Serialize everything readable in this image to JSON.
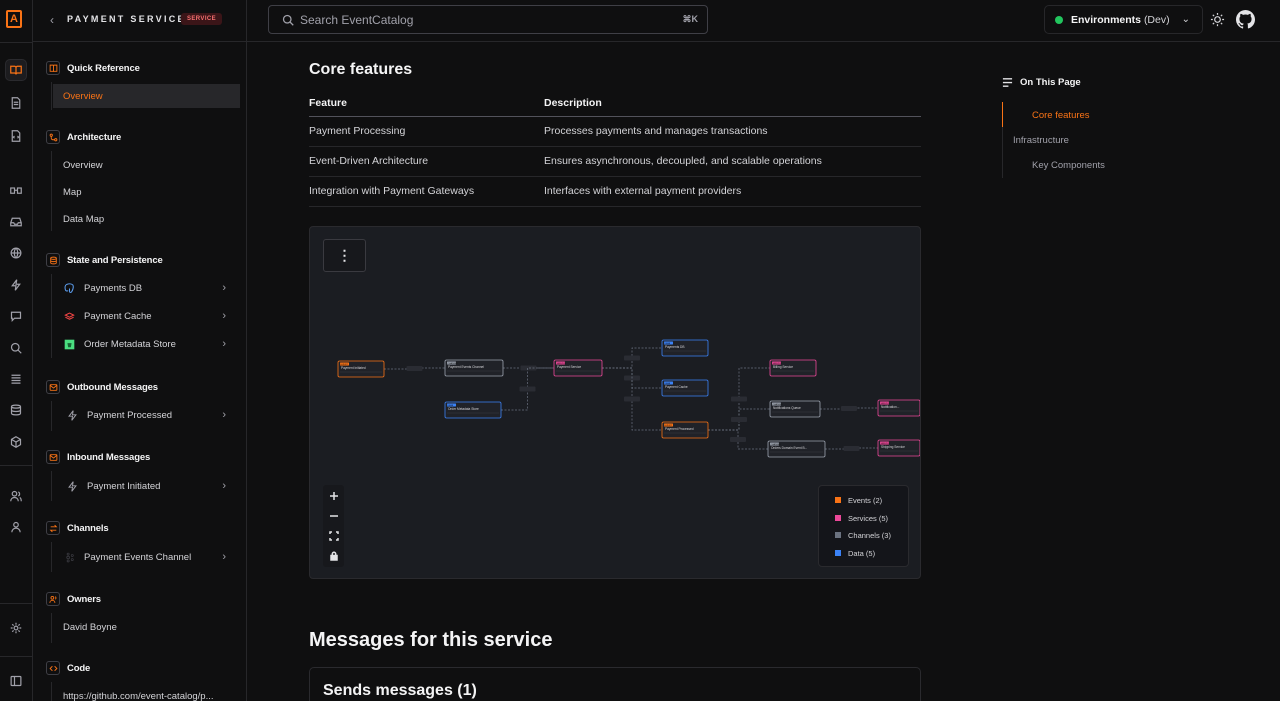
{
  "app": {
    "brand_letter": "A"
  },
  "sidebar": {
    "back": "‹",
    "title": "PAYMENT SERVICE",
    "badge": "SERVICE",
    "sections": [
      {
        "label": "Quick Reference",
        "items": [
          {
            "label": "Overview"
          }
        ]
      },
      {
        "label": "Architecture",
        "items": [
          {
            "label": "Overview"
          },
          {
            "label": "Map"
          },
          {
            "label": "Data Map"
          }
        ]
      },
      {
        "label": "State and Persistence",
        "items": [
          {
            "label": "Payments DB"
          },
          {
            "label": "Payment Cache"
          },
          {
            "label": "Order Metadata Store"
          }
        ]
      },
      {
        "label": "Outbound Messages",
        "items": [
          {
            "label": "Payment Processed"
          }
        ]
      },
      {
        "label": "Inbound Messages",
        "items": [
          {
            "label": "Payment Initiated"
          }
        ]
      },
      {
        "label": "Channels",
        "items": [
          {
            "label": "Payment Events Channel"
          }
        ]
      },
      {
        "label": "Owners",
        "items": [
          {
            "label": "David Boyne"
          }
        ]
      },
      {
        "label": "Code",
        "items": [
          {
            "label": "https://github.com/event-catalog/p..."
          }
        ]
      }
    ]
  },
  "topbar": {
    "search_placeholder": "Search EventCatalog",
    "shortcut": "⌘K",
    "env_label": "Environments",
    "env_value": "(Dev)",
    "env_status_color": "#22c55e"
  },
  "main": {
    "core_title": "Core features",
    "table": {
      "headers": [
        "Feature",
        "Description"
      ],
      "rows": [
        [
          "Payment Processing",
          "Processes payments and manages transactions"
        ],
        [
          "Event-Driven Architecture",
          "Ensures asynchronous, decoupled, and scalable operations"
        ],
        [
          "Integration with Payment Gateways",
          "Interfaces with external payment providers"
        ]
      ]
    },
    "graph": {
      "menu_icon": "⋮",
      "legend": [
        {
          "label": "Events (2)",
          "color": "#f97316"
        },
        {
          "label": "Services (5)",
          "color": "#ec4899"
        },
        {
          "label": "Channels (3)",
          "color": "#6b7280"
        },
        {
          "label": "Data (5)",
          "color": "#3b82f6"
        }
      ],
      "nodes": [
        {
          "label": "Payment Initiated",
          "tag": "EVENT",
          "kind": "event"
        },
        {
          "label": "Payment Events Channel",
          "tag": "CHANNEL",
          "kind": "channel"
        },
        {
          "label": "Order Metadata Store",
          "tag": "DATA",
          "kind": "data"
        },
        {
          "label": "Payment Service",
          "tag": "SERVICE",
          "kind": "service"
        },
        {
          "label": "Payments DB",
          "tag": "DATA",
          "kind": "data"
        },
        {
          "label": "Payment Cache",
          "tag": "DATA",
          "kind": "data"
        },
        {
          "label": "Payment Processed",
          "tag": "EVENT",
          "kind": "event"
        },
        {
          "label": "Billing Service",
          "tag": "SERVICE",
          "kind": "service"
        },
        {
          "label": "Notifications Queue",
          "tag": "CHANNEL",
          "kind": "channel"
        },
        {
          "label": "Orders Domain Event B...",
          "tag": "CHANNEL",
          "kind": "channel"
        },
        {
          "label": "Notification...",
          "tag": "SERVICE",
          "kind": "service"
        },
        {
          "label": "Shipping Service",
          "tag": "SERVICE",
          "kind": "service"
        }
      ]
    },
    "messages_title": "Messages for this service",
    "sends_title": "Sends messages (1)"
  },
  "toc": {
    "title": "On This Page",
    "items": [
      "Core features",
      "Infrastructure",
      "Key Components"
    ]
  }
}
